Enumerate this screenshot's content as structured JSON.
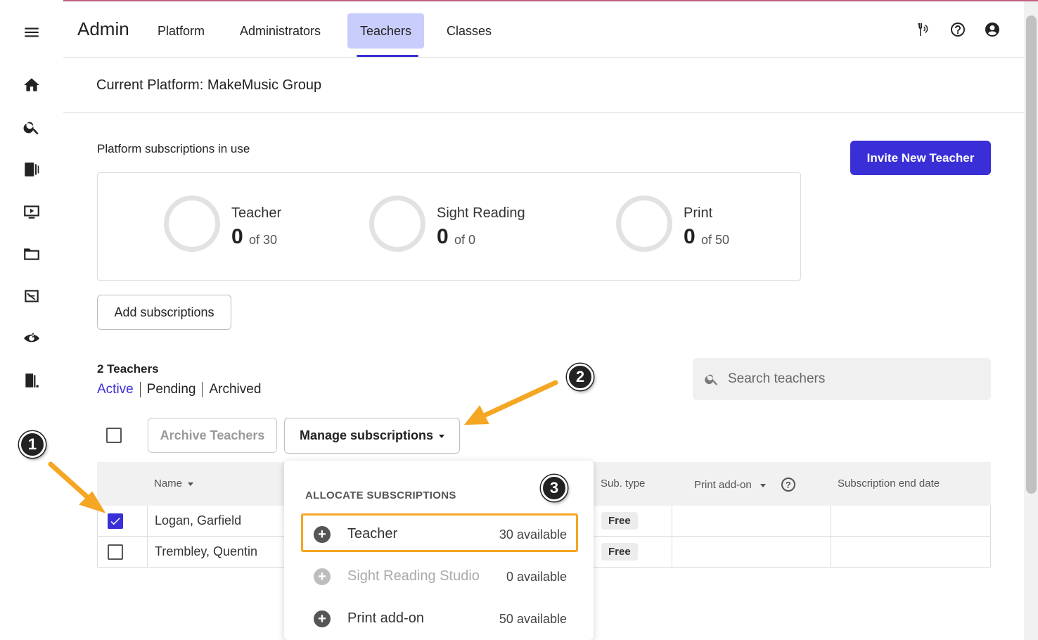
{
  "header": {
    "brand": "Admin",
    "nav": [
      "Platform",
      "Administrators",
      "Teachers",
      "Classes"
    ],
    "active_nav": "Teachers"
  },
  "rail_icons": [
    "menu-icon",
    "home-icon",
    "search-icon",
    "library-icon",
    "assignment-icon",
    "folder-icon",
    "compose-icon",
    "ear-training-icon",
    "exit-icon"
  ],
  "header_icons": [
    "tuner-icon",
    "help-icon",
    "account-icon"
  ],
  "platform": {
    "title": "Current Platform: MakeMusic Group"
  },
  "subscriptions": {
    "section_title": "Platform subscriptions in use",
    "items": [
      {
        "name": "Teacher",
        "used": "0",
        "of": "of 30"
      },
      {
        "name": "Sight Reading",
        "used": "0",
        "of": "of 0"
      },
      {
        "name": "Print",
        "used": "0",
        "of": "of 50"
      }
    ],
    "add_button": "Add subscriptions"
  },
  "invite_button": "Invite New Teacher",
  "teachers": {
    "count_label": "2 Teachers",
    "filters": [
      "Active",
      "Pending",
      "Archived"
    ],
    "search_placeholder": "Search teachers",
    "archive_button": "Archive Teachers",
    "manage_button": "Manage subscriptions",
    "columns": {
      "name": "Name",
      "sub_type": "Sub. type",
      "print_addon": "Print add-on",
      "end_date": "Subscription end date"
    },
    "rows": [
      {
        "name": "Logan, Garfield",
        "sub_type": "Free",
        "checked": true
      },
      {
        "name": "Trembley, Quentin",
        "sub_type": "Free",
        "checked": false
      }
    ]
  },
  "dropdown": {
    "heading": "ALLOCATE SUBSCRIPTIONS",
    "items": [
      {
        "label": "Teacher",
        "available": "30 available",
        "disabled": false
      },
      {
        "label": "Sight Reading Studio",
        "available": "0 available",
        "disabled": true
      },
      {
        "label": "Print add-on",
        "available": "50 available",
        "disabled": false
      }
    ]
  },
  "callouts": [
    "1",
    "2",
    "3"
  ],
  "colors": {
    "accent": "#3a2fd6",
    "nav_active_bg": "#c9cdfb",
    "annotation": "#f5a623"
  }
}
